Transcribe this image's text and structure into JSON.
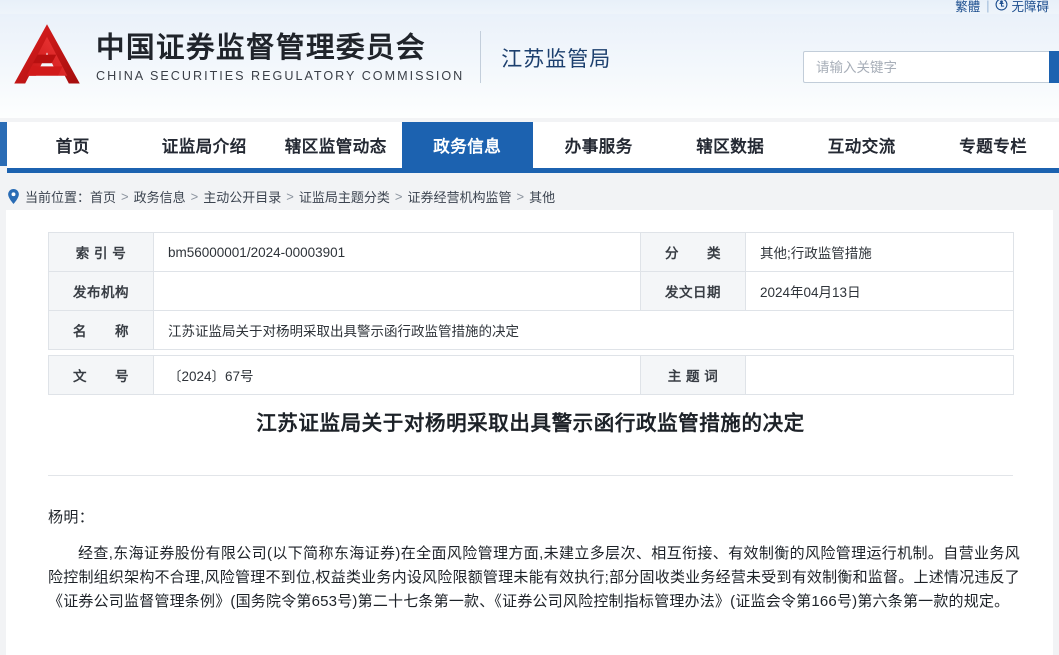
{
  "topbar": {
    "traditional_label": "繁體",
    "separator": "|",
    "accessibility_label": "无障碍",
    "accessibility_icon": "wheelchair-icon"
  },
  "header": {
    "logo_icon": "csrc-emblem-logo",
    "org_name_cn": "中国证券监督管理委员会",
    "org_name_en": "CHINA SECURITIES REGULATORY COMMISSION",
    "bureau_name": "江苏监管局"
  },
  "search": {
    "placeholder": "请输入关键字",
    "value": "",
    "button_icon": "search-icon",
    "button_color": "#1c62b0"
  },
  "nav": {
    "active_index": 3,
    "accent_color": "#1c62b0",
    "items": [
      {
        "label": "首页"
      },
      {
        "label": "证监局介绍"
      },
      {
        "label": "辖区监管动态"
      },
      {
        "label": "政务信息"
      },
      {
        "label": "办事服务"
      },
      {
        "label": "辖区数据"
      },
      {
        "label": "互动交流"
      },
      {
        "label": "专题专栏"
      }
    ]
  },
  "breadcrumb": {
    "pin_icon": "location-pin-icon",
    "prefix": "当前位置：",
    "separator": ">",
    "items": [
      {
        "label": "首页"
      },
      {
        "label": "政务信息"
      },
      {
        "label": "主动公开目录"
      },
      {
        "label": "证监局主题分类"
      },
      {
        "label": "证券经营机构监管"
      },
      {
        "label": "其他"
      }
    ]
  },
  "info_table": {
    "rows": [
      {
        "left_label": "索 引 号",
        "left_value": "bm56000001/2024-00003901",
        "right_label": "分　　类",
        "right_value": "其他;行政监管措施"
      },
      {
        "left_label": "发布机构",
        "left_value": "",
        "right_label": "发文日期",
        "right_value": "2024年04月13日"
      },
      {
        "left_label": "名　　称",
        "left_value": "江苏证监局关于对杨明采取出具警示函行政监管措施的决定",
        "right_label": "",
        "right_value": ""
      },
      {
        "left_label": "文　　号",
        "left_value": "〔2024〕67号",
        "right_label": "主 题 词",
        "right_value": ""
      }
    ]
  },
  "article": {
    "title": "江苏证监局关于对杨明采取出具警示函行政监管措施的决定",
    "salutation": "杨明：",
    "paragraph": "经查,东海证券股份有限公司(以下简称东海证券)在全面风险管理方面,未建立多层次、相互衔接、有效制衡的风险管理运行机制。自营业务风险控制组织架构不合理,风险管理不到位,权益类业务内设风险限额管理未能有效执行;部分固收类业务经营未受到有效制衡和监督。上述情况违反了《证券公司监督管理条例》(国务院令第653号)第二十七条第一款、《证券公司风险控制指标管理办法》(证监会令第166号)第六条第一款的规定。"
  }
}
